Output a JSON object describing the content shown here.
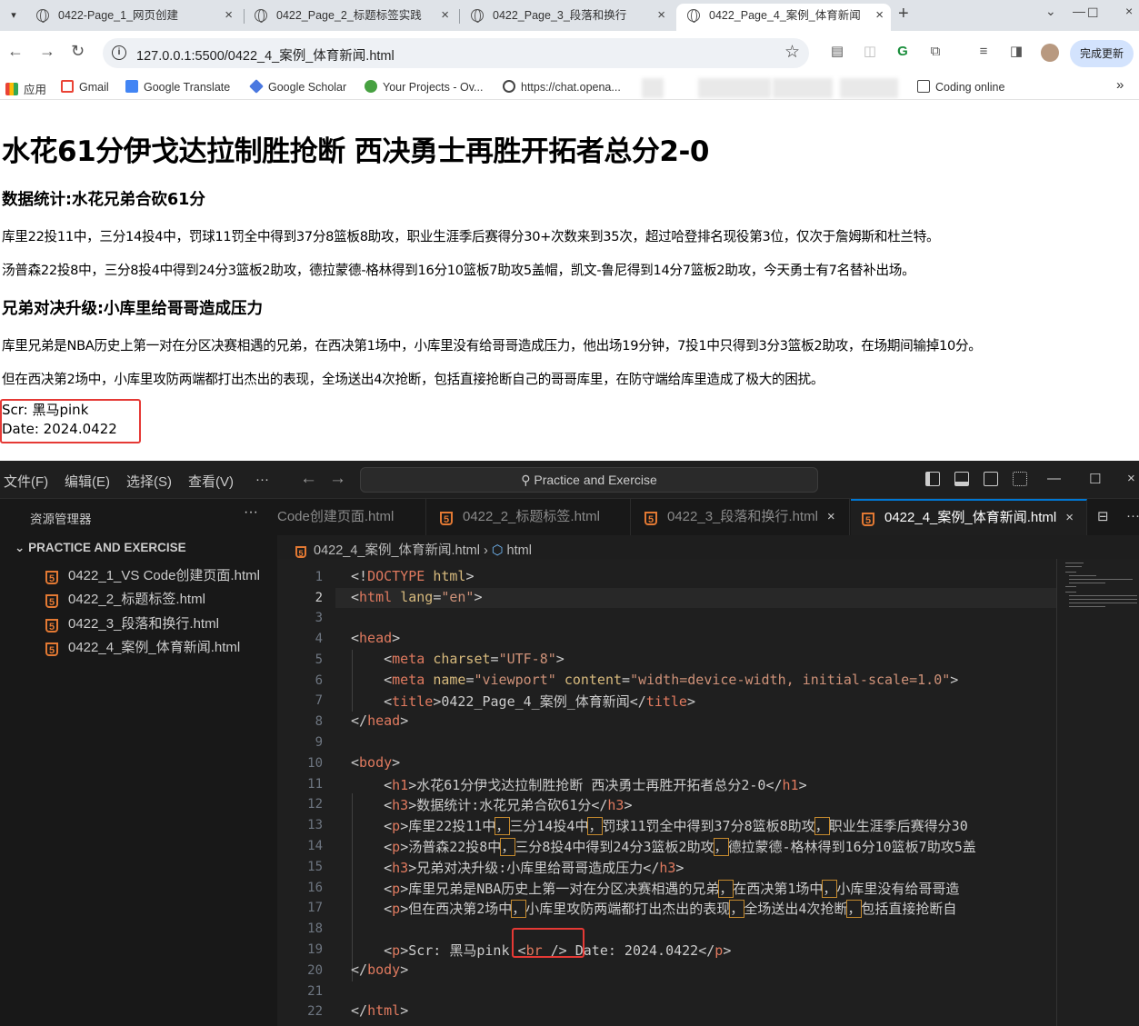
{
  "browser": {
    "tabs": [
      {
        "title": "0422-Page_1_网页创建"
      },
      {
        "title": "0422_Page_2_标题标签实践"
      },
      {
        "title": "0422_Page_3_段落和换行"
      },
      {
        "title": "0422_Page_4_案例_体育新闻"
      }
    ],
    "active_tab": 3,
    "url": "127.0.0.1:5500/0422_4_案例_体育新闻.html",
    "update_button": "完成更新",
    "bookmarks": [
      {
        "label": "应用",
        "icon": "apps-grid-icon"
      },
      {
        "label": "Gmail",
        "icon": "gmail-icon"
      },
      {
        "label": "Google Translate",
        "icon": "translate-icon"
      },
      {
        "label": "Google Scholar",
        "icon": "scholar-icon"
      },
      {
        "label": "Your Projects - Ov...",
        "icon": "overleaf-icon"
      },
      {
        "label": "https://chat.opena...",
        "icon": "chatgpt-icon"
      },
      {
        "label": "Coding online",
        "icon": "folder-icon"
      }
    ]
  },
  "page": {
    "h1": "水花61分伊戈达拉制胜抢断 西决勇士再胜开拓者总分2-0",
    "h3_1": "数据统计:水花兄弟合砍61分",
    "p1": "库里22投11中，三分14投4中，罚球11罚全中得到37分8篮板8助攻，职业生涯季后赛得分30+次数来到35次，超过哈登排名现役第3位，仅次于詹姆斯和杜兰特。",
    "p2": "汤普森22投8中，三分8投4中得到24分3篮板2助攻，德拉蒙德-格林得到16分10篮板7助攻5盖帽，凯文-鲁尼得到14分7篮板2助攻，今天勇士有7名替补出场。",
    "h3_2": "兄弟对决升级:小库里给哥哥造成压力",
    "p3": "库里兄弟是NBA历史上第一对在分区决赛相遇的兄弟，在西决第1场中，小库里没有给哥哥造成压力，他出场19分钟，7投1中只得到3分3篮板2助攻，在场期间输掉10分。",
    "p4": "但在西决第2场中，小库里攻防两端都打出杰出的表现，全场送出4次抢断，包括直接抢断自己的哥哥库里，在防守端给库里造成了极大的困扰。",
    "credit_line1": "Scr: 黑马pink",
    "credit_line2": "Date: 2024.0422"
  },
  "vscode": {
    "menus": [
      "文件(F)",
      "编辑(E)",
      "选择(S)",
      "查看(V)",
      "···"
    ],
    "command_center": "Practice and Exercise",
    "explorer_title": "资源管理器",
    "workspace": "PRACTICE AND EXERCISE",
    "files": [
      "0422_1_VS Code创建页面.html",
      "0422_2_标题标签.html",
      "0422_3_段落和换行.html",
      "0422_4_案例_体育新闻.html"
    ],
    "editor_tabs": [
      {
        "label": "Code创建页面.html",
        "active": false
      },
      {
        "label": "0422_2_标题标签.html",
        "active": false
      },
      {
        "label": "0422_3_段落和换行.html",
        "active": false
      },
      {
        "label": "0422_4_案例_体育新闻.html",
        "active": true
      }
    ],
    "breadcrumb_file": "0422_4_案例_体育新闻.html",
    "breadcrumb_node": "html",
    "current_line": 2,
    "code": {
      "l13_text": "库里22投11中",
      "l13_b": "三分14投4中",
      "l13_c": "罚球11罚全中得到37分8篮板8助攻",
      "l13_d": "职业生涯季后赛得分30",
      "l14_text": "汤普森22投8中",
      "l14_b": "三分8投4中得到24分3篮板2助攻",
      "l14_c": "德拉蒙德-格林得到16分10篮板7助攻5盖",
      "l16_text": "库里兄弟是NBA历史上第一对在分区决赛相遇的兄弟",
      "l16_b": "在西决第1场中",
      "l16_c": "小库里没有给哥哥造",
      "l17_text": "但在西决第2场中",
      "l17_b": "小库里攻防两端都打出杰出的表现",
      "l17_c": "全场送出4次抢断",
      "l17_d": "包括直接抢断自"
    }
  }
}
